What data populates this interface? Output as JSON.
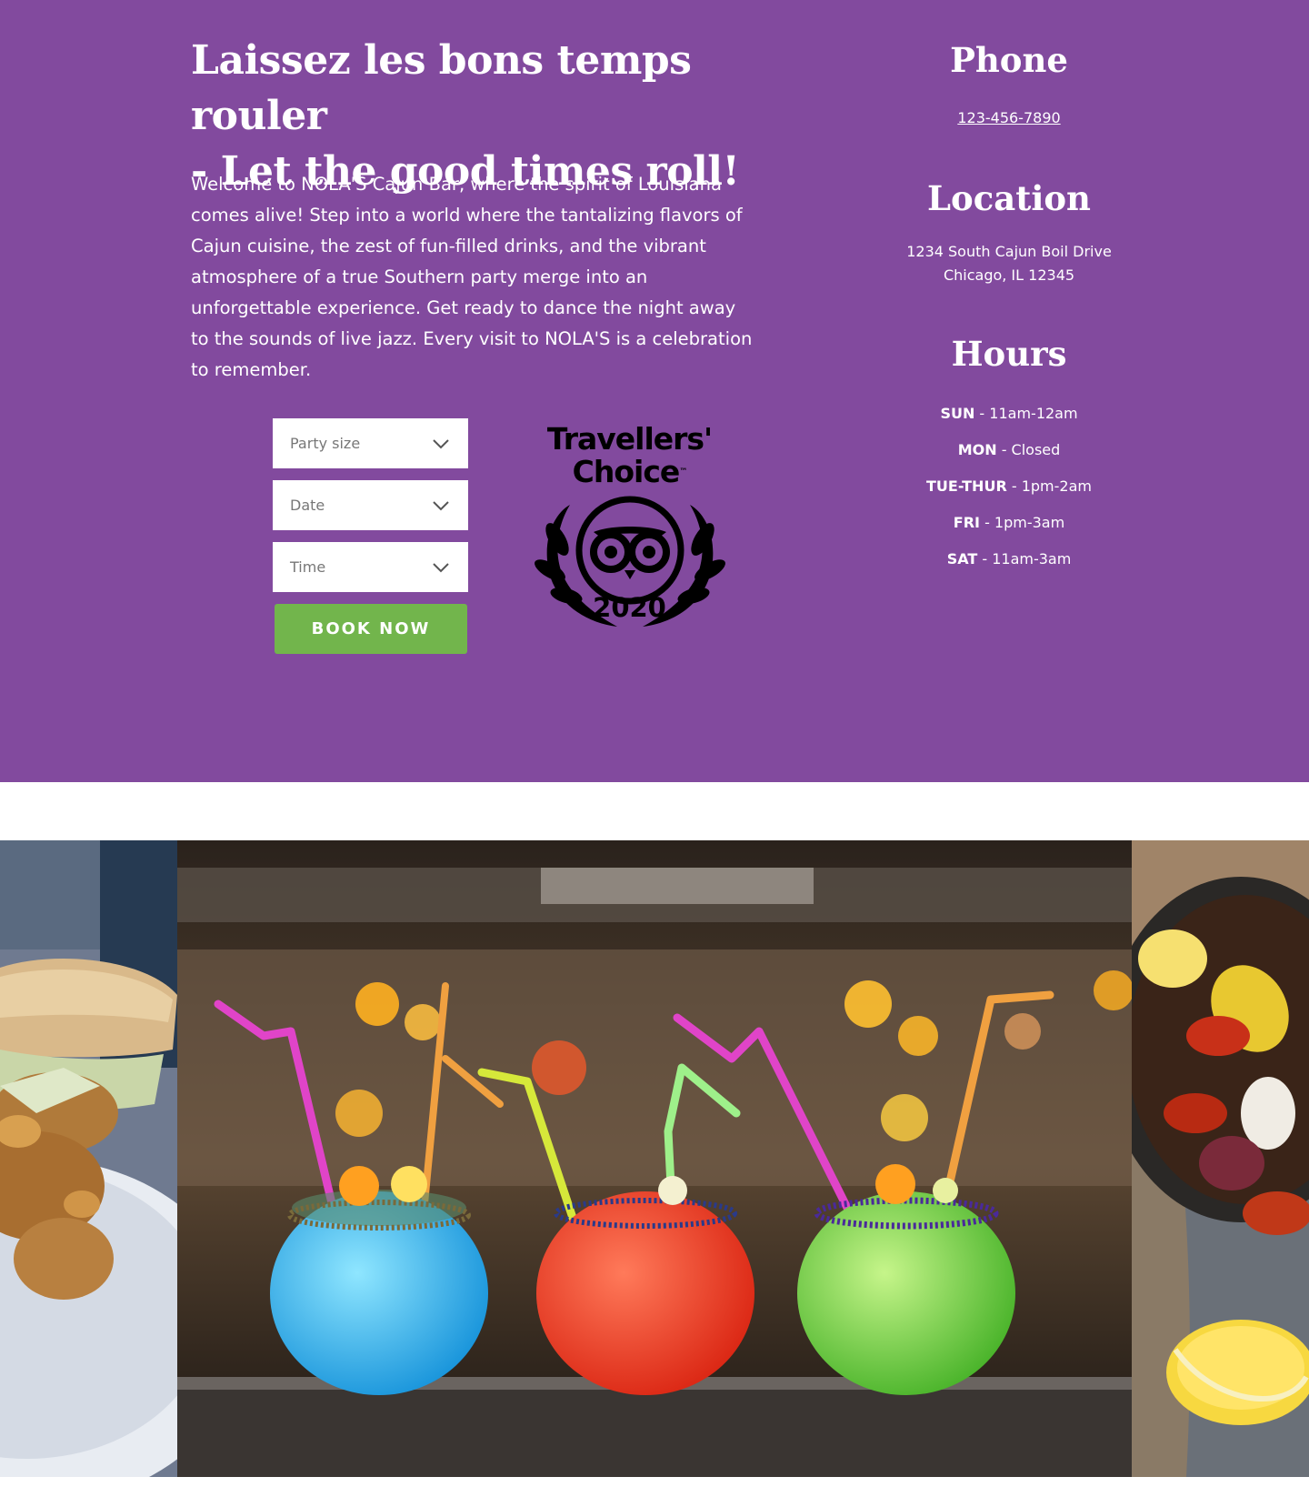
{
  "hero": {
    "headline_line1": "Laissez les bons temps rouler",
    "headline_line2": "- Let the good times roll!",
    "intro": "Welcome to NOLA'S Cajun Bar, where the spirit of Louisiana comes alive! Step into a world where the tantalizing flavors of Cajun cuisine, the zest of fun-filled drinks, and the vibrant atmosphere of a true Southern party merge into an unforgettable experience. Get ready to dance the night away to the sounds of live jazz. Every visit to NOLA'S is a celebration to remember.",
    "background_color": "#824a9e"
  },
  "booking": {
    "party_size_label": "Party size",
    "date_label": "Date",
    "time_label": "Time",
    "book_button": "BOOK NOW",
    "button_color": "#72b54c",
    "dropdown_icon": "chevron-down-icon"
  },
  "badge": {
    "line1": "Travellers'",
    "line2": "Choice",
    "tm": "™",
    "year": "2020",
    "icon": "tripadvisor-owl-laurel-icon"
  },
  "contact": {
    "phone_title": "Phone",
    "phone_number": "123-456-7890",
    "location_title": "Location",
    "address_line1": "1234 South Cajun Boil Drive",
    "address_line2": "Chicago, IL 12345",
    "hours_title": "Hours",
    "hours": [
      {
        "day": "SUN",
        "time": " - 11am-12am"
      },
      {
        "day": "MON",
        "time": " - Closed"
      },
      {
        "day": "TUE-THUR",
        "time": " - 1pm-2am"
      },
      {
        "day": "FRI",
        "time": " - 1pm-3am"
      },
      {
        "day": "SAT",
        "time": " - 11am-3am"
      }
    ]
  },
  "gallery": {
    "images": [
      {
        "name": "fried-oyster-sandwich-photo"
      },
      {
        "name": "colorful-fishbowl-cocktails-photo"
      },
      {
        "name": "crawfish-boil-photo"
      }
    ]
  }
}
